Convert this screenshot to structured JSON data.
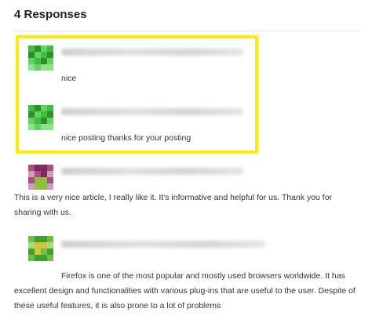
{
  "header": {
    "title": "4 Responses"
  },
  "comments": [
    {
      "text": "nice",
      "avatar_colors": [
        "#2f8f2f",
        "#3fbf3f",
        "#5fd45f",
        "#8fe08f"
      ]
    },
    {
      "text": "nice posting thanks for your posting",
      "avatar_colors": [
        "#2f8f2f",
        "#3fbf3f",
        "#5fd45f",
        "#8fe08f"
      ]
    },
    {
      "text": "This is a very nice article, I really like it. It's informative and helpful for us. Thank you for sharing with us.",
      "avatar_colors": [
        "#7a2f5a",
        "#b04a80",
        "#8fbf3f",
        "#c9a0b8"
      ]
    },
    {
      "text": "Firefox is one of the most popular and mostly used browsers worldwide. It has excellent design and functionalities with various plug-ins that are useful to the user. Despite of these useful features, it is also prone to a lot of problems",
      "avatar_colors": [
        "#3f9f2f",
        "#6fc03f",
        "#d8c23a",
        "#a8d880"
      ]
    }
  ],
  "highlight_color": "#ffec00"
}
